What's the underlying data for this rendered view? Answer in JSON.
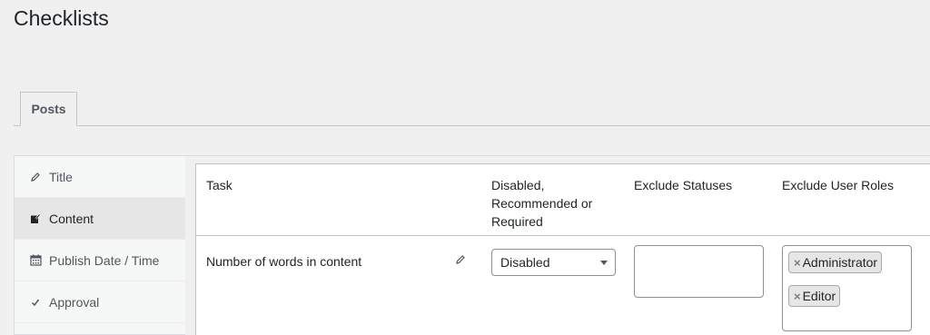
{
  "page": {
    "title": "Checklists"
  },
  "tabs": [
    {
      "label": "Posts"
    }
  ],
  "sidebar": {
    "items": [
      {
        "label": "Title",
        "icon": "pencil-icon"
      },
      {
        "label": "Content",
        "icon": "edit-page-icon"
      },
      {
        "label": "Publish Date / Time",
        "icon": "calendar-icon"
      },
      {
        "label": "Approval",
        "icon": "checkmark-icon"
      }
    ]
  },
  "table": {
    "headers": {
      "task": "Task",
      "requirement": "Disabled, Recommended or Required",
      "statuses": "Exclude Statuses",
      "roles": "Exclude User Roles"
    },
    "rows": [
      {
        "task": "Number of words in content",
        "requirement": "Disabled",
        "roles": [
          "Administrator",
          "Editor"
        ],
        "remove_glyph": "×"
      }
    ]
  }
}
